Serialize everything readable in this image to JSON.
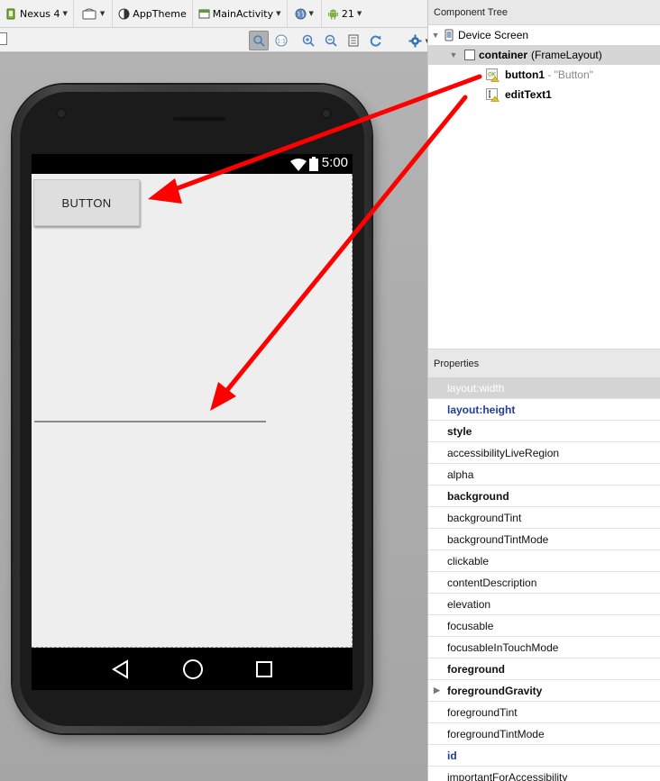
{
  "toolbar": {
    "device": "Nexus 4",
    "theme": "AppTheme",
    "activity": "MainActivity",
    "api": "21"
  },
  "phone": {
    "status_time": "5:00",
    "button_text": "BUTTON"
  },
  "component_tree": {
    "title": "Component Tree",
    "root": "Device Screen",
    "container_id": "container",
    "container_type": "(FrameLayout)",
    "button_id": "button1",
    "button_dash": " - ",
    "button_text": "\"Button\"",
    "edit_id": "editText1"
  },
  "properties": {
    "title": "Properties",
    "items": [
      "layout:width",
      "layout:height",
      "style",
      "accessibilityLiveRegion",
      "alpha",
      "background",
      "backgroundTint",
      "backgroundTintMode",
      "clickable",
      "contentDescription",
      "elevation",
      "focusable",
      "focusableInTouchMode",
      "foreground",
      "foregroundGravity",
      "foregroundTint",
      "foregroundTintMode",
      "id",
      "importantForAccessibility"
    ]
  },
  "colors": {
    "arrow": "#ff0000",
    "selection": "#d6d6d6",
    "property_link": "#1f3d9a"
  }
}
